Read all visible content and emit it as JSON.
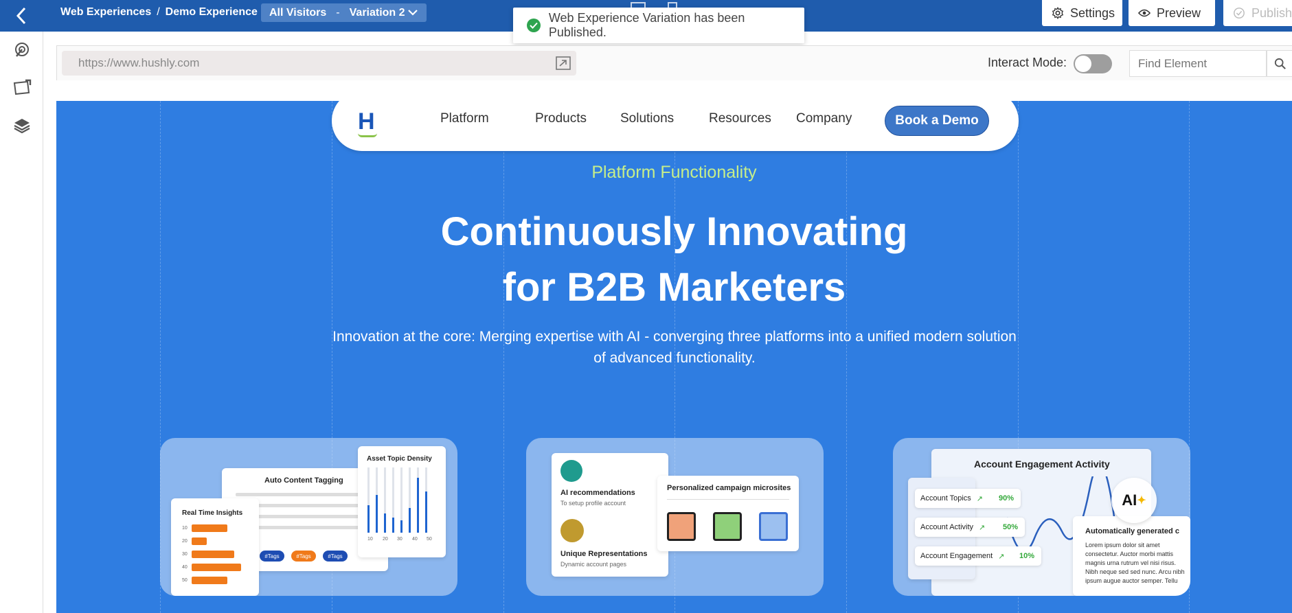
{
  "header": {
    "breadcrumb": [
      "Web Experiences",
      "Demo Experience"
    ],
    "audience": "All Visitors",
    "variation": "Variation 2",
    "settings_label": "Settings",
    "preview_label": "Preview",
    "publish_label": "Publish"
  },
  "toast": {
    "message": "Web Experience Variation has been Published."
  },
  "toolbar": {
    "url": "https://www.hushly.com",
    "interact_mode_label": "Interact Mode:",
    "interact_mode_on": false,
    "find_placeholder": "Find Element"
  },
  "site": {
    "logo": "H",
    "nav": [
      "Platform",
      "Products",
      "Solutions",
      "Resources",
      "Company"
    ],
    "cta": "Book a Demo",
    "eyebrow": "Platform Functionality",
    "headline_line1": "Continuously Innovating",
    "headline_line2": "for B2B Marketers",
    "subcopy": "Innovation at the core: Merging expertise with AI - converging three platforms into a unified modern solution of advanced functionality."
  },
  "cards": {
    "card1": {
      "auto_tagging": "Auto Content Tagging",
      "asset_density": "Asset Topic Density",
      "realtime": "Real Time Insights",
      "tags": [
        "#Tags",
        "#Tags",
        "#Tags"
      ],
      "bar_axis": [
        "10",
        "20",
        "30",
        "40",
        "50"
      ],
      "col_axis": [
        "10",
        "20",
        "30",
        "40",
        "50"
      ]
    },
    "card2": {
      "ai_title": "AI recommendations",
      "ai_sub": "To setup profile account",
      "unique_title": "Unique Representations",
      "unique_sub": "Dynamic account pages",
      "micro_title": "Personalized campaign microsites"
    },
    "card3": {
      "title": "Account Engagement Activity",
      "metrics": [
        {
          "label": "Account Topics",
          "value": "90%"
        },
        {
          "label": "Account Activity",
          "value": "50%"
        },
        {
          "label": "Account Engagement",
          "value": "10%"
        }
      ],
      "ai_badge": "AI",
      "auto_title": "Automatically generated c",
      "auto_body": "Lorem ipsum dolor sit amet consectetur. Auctor morbi mattis magnis urna rutrum vel nisi risus. Nibh neque sed sed nunc. Arcu nibh ipsum augue auctor semper. Tellu"
    }
  },
  "colors": {
    "topbar": "#1f5cad",
    "page_bg": "#2f7de1",
    "accent_green": "#c6ee8a",
    "bar_orange": "#f07a1a"
  }
}
